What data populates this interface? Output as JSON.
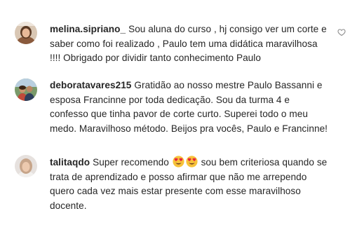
{
  "comments": [
    {
      "username": "melina.sipriano_",
      "text": "Sou aluna do curso , hj consigo ver um corte e saber como foi realizado , Paulo tem uma didática maravilhosa !!!! Obrigado por dividir tanto conhecimento Paulo",
      "avatar_icon": "user-avatar-photo"
    },
    {
      "username": "deboratavares215",
      "text": "Gratidão ao nosso mestre Paulo Bassanni e esposa Francinne por toda dedicação. Sou da turma 4 e confesso que tinha pavor de corte curto. Superei todo o meu medo. Maravilhoso método. Beijos pra vocês, Paulo e Francinne!",
      "avatar_icon": "user-avatar-photo"
    },
    {
      "username": "talitaqdo",
      "text_before": "Super recomendo",
      "emoji_name": "smiling-face-with-heart-eyes-emoji",
      "text_after": "sou bem criteriosa quando se trata de aprendizado e posso afirmar que não me arrependo quero cada vez mais estar presente com esse maravilhoso docente.",
      "avatar_icon": "user-avatar-photo"
    }
  ]
}
